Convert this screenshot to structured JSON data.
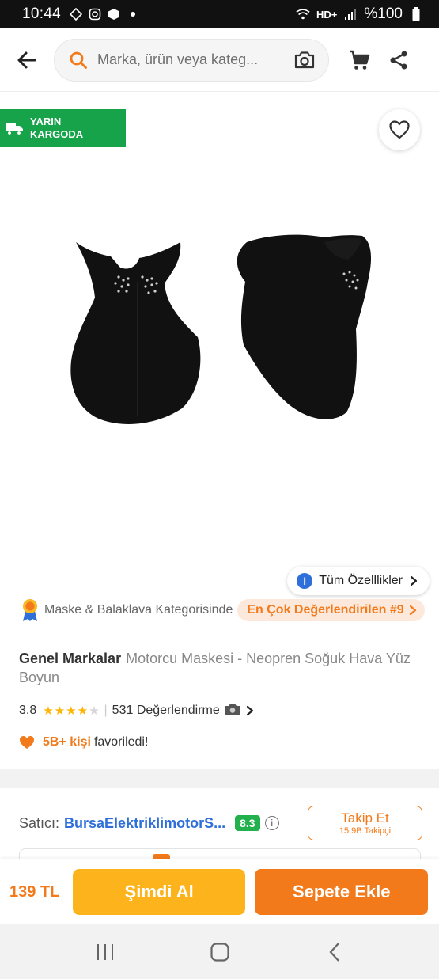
{
  "status_bar": {
    "time": "10:44",
    "battery": "%100",
    "icons": [
      "navigation-icon",
      "instagram-icon",
      "package-icon",
      "dot-icon",
      "wifi-icon",
      "hd-voice-icon",
      "signal-icon",
      "battery-icon"
    ],
    "network_label": "HD+"
  },
  "header": {
    "search_placeholder": "Marka, ürün veya kateg...",
    "icons": [
      "back-arrow-icon",
      "search-icon",
      "camera-icon",
      "cart-icon",
      "share-icon"
    ]
  },
  "product": {
    "cargo_badge": "YARIN KARGODA",
    "all_features": "Tüm Özelllikler",
    "category_text": "Maske & Balaklava Kategorisinde",
    "rank_text": "En Çok Değerlendirilen #9",
    "brand": "Genel Markalar",
    "name": "Motorcu Maskesi - Neopren Soğuk Hava Yüz Boyun",
    "rating": "3.8",
    "rating_value": 3.8,
    "rating_max": 5,
    "review_count": "531 Değerlendirme",
    "fav_count": "5B+ kişi",
    "fav_text": "favoriledi!"
  },
  "seller": {
    "label": "Satıcı:",
    "name": "BursaElektriklimotorS...",
    "score": "8.3",
    "follow_label": "Takip Et",
    "followers": "15,9B Takipçi"
  },
  "action_bar": {
    "price": "139 TL",
    "buy_now": "Şimdi Al",
    "add_to_cart": "Sepete Ekle"
  },
  "colors": {
    "accent": "#f27a1a",
    "buy_now": "#fdb31b",
    "cargo_green": "#17a34a",
    "seller_blue": "#2f6fd9",
    "score_green": "#22b14c"
  }
}
